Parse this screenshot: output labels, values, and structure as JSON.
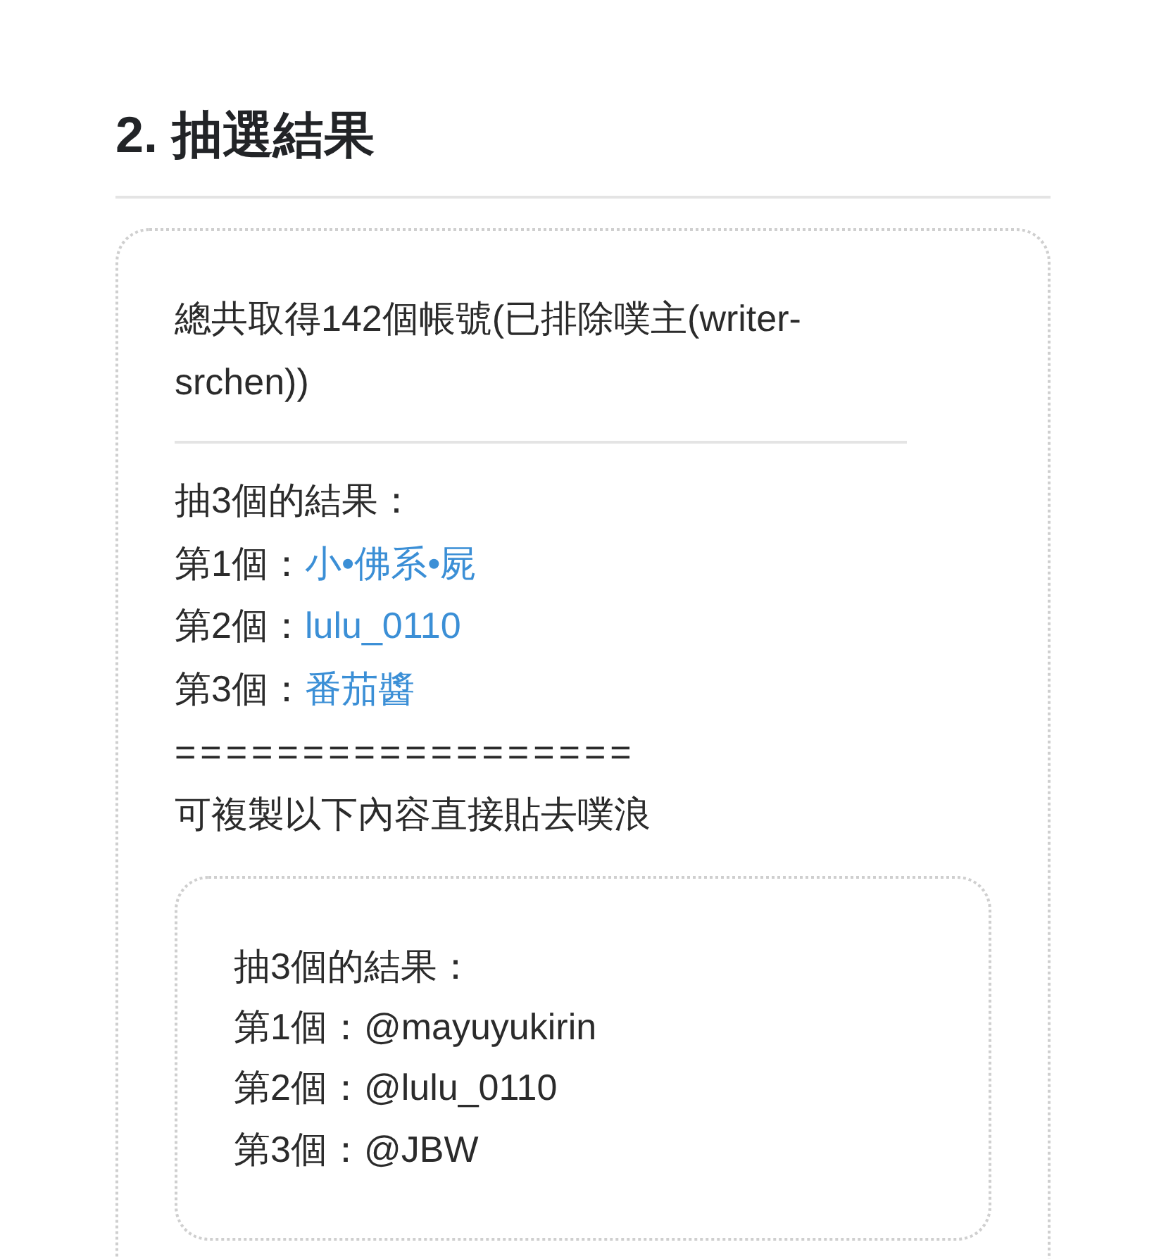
{
  "heading": "2. 抽選結果",
  "result_card": {
    "summary": "總共取得142個帳號(已排除噗主(writer-srchen))",
    "draw_title": "抽3個的結果：",
    "winners": [
      {
        "label": "第1個：",
        "name": "小•佛系•屍"
      },
      {
        "label": "第2個：",
        "name": "lulu_0110"
      },
      {
        "label": "第3個：",
        "name": "番茄醬"
      }
    ],
    "separator": "==================",
    "copy_hint": "可複製以下內容直接貼去噗浪",
    "copy_box": {
      "lines": [
        "抽3個的結果：",
        "第1個：@mayuyukirin",
        "第2個：@lulu_0110",
        "第3個：@JBW"
      ]
    }
  }
}
